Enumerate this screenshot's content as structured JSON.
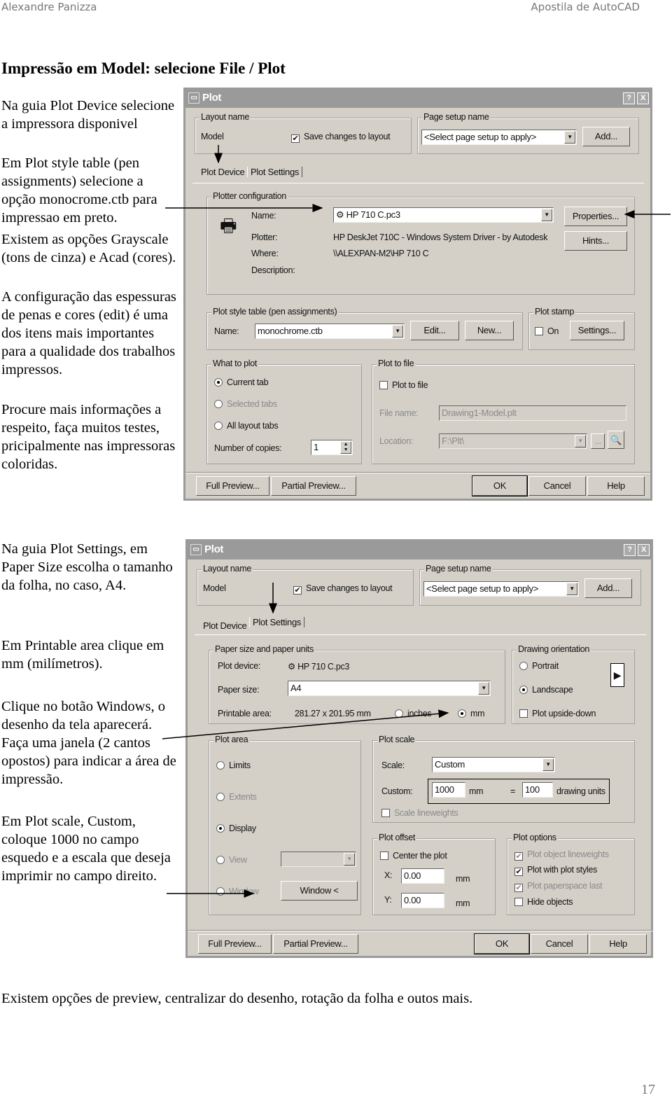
{
  "header": {
    "author": "Alexandre Panizza",
    "doc_title": "Apostila de AutoCAD"
  },
  "section_title": "Impressão em Model: selecione File / Plot",
  "left_text_1": [
    "Na guia Plot Device selecione a impressora disponivel",
    "Em Plot style table (pen assignments) selecione a opção monocrome.ctb para impressao em preto.",
    "Existem as opções Grayscale (tons de cinza) e Acad (cores).",
    "A configuração das espessuras de penas e cores (edit) é uma dos itens mais importantes para a qualidade dos trabalhos impressos.",
    "Procure mais informações a respeito, faça muitos testes, pricipalmente nas impressoras coloridas."
  ],
  "left_text_2": [
    "Na guia Plot Settings, em Paper Size escolha o tamanho da folha, no caso, A4.",
    "Em Printable area clique em mm (milímetros).",
    "Clique no botão Windows, o desenho da tela aparecerá. Faça uma janela (2 cantos opostos) para indicar a área de impressão.",
    "Em Plot scale, Custom, coloque 1000 no campo esquedo e a escala que deseja imprimir no campo direito."
  ],
  "footer_text": "Existem opções de preview, centralizar do desenho, rotação da folha e outos mais.",
  "page_number": "17",
  "dialog_common": {
    "title": "Plot",
    "help_btn": "?",
    "close_btn": "X",
    "layout_name_group": "Layout name",
    "layout_name": "Model",
    "save_changes": "Save changes to layout",
    "page_setup_group": "Page setup name",
    "page_setup_value": "<Select page setup to apply>",
    "add_btn": "Add...",
    "tab_device": "Plot Device",
    "tab_settings": "Plot Settings",
    "full_preview": "Full Preview...",
    "partial_preview": "Partial Preview...",
    "ok": "OK",
    "cancel": "Cancel",
    "help": "Help"
  },
  "dialog1": {
    "plotter_group": "Plotter configuration",
    "name_label": "Name:",
    "name_value": "HP 710 C.pc3",
    "plotter_label": "Plotter:",
    "plotter_value": "HP DeskJet 710C - Windows System Driver - by Autodesk",
    "where_label": "Where:",
    "where_value": "\\\\ALEXPAN-M2\\HP 710 C",
    "description_label": "Description:",
    "properties_btn": "Properties...",
    "hints_btn": "Hints...",
    "style_group": "Plot style table (pen assignments)",
    "style_name_label": "Name:",
    "style_value": "monochrome.ctb",
    "edit_btn": "Edit...",
    "new_btn": "New...",
    "stamp_group": "Plot stamp",
    "stamp_on": "On",
    "stamp_settings": "Settings...",
    "what_group": "What to plot",
    "current_tab": "Current tab",
    "selected_tabs": "Selected tabs",
    "all_layout_tabs": "All layout tabs",
    "copies_label": "Number of copies:",
    "copies_value": "1",
    "file_group": "Plot to file",
    "plot_to_file": "Plot to file",
    "file_name_label": "File name:",
    "file_name_value": "Drawing1-Model.plt",
    "location_label": "Location:",
    "location_value": "F:\\Plt\\",
    "browse_btn": "..."
  },
  "dialog2": {
    "paper_group": "Paper size and paper units",
    "plot_device_label": "Plot device:",
    "plot_device_value": "HP 710 C.pc3",
    "paper_size_label": "Paper size:",
    "paper_size_value": "A4",
    "printable_label": "Printable area:",
    "printable_value": "281.27 x 201.95 mm",
    "inches": "inches",
    "mm": "mm",
    "orient_group": "Drawing orientation",
    "portrait": "Portrait",
    "landscape": "Landscape",
    "upside_down": "Plot upside-down",
    "area_group": "Plot area",
    "limits": "Limits",
    "extents": "Extents",
    "display": "Display",
    "view": "View",
    "window": "Window",
    "window_btn": "Window <",
    "scale_group": "Plot scale",
    "scale_label": "Scale:",
    "scale_value": "Custom",
    "custom_label": "Custom:",
    "custom_left": "1000",
    "custom_unit": "mm",
    "equals": "=",
    "custom_right": "100",
    "drawing_units": "drawing units",
    "scale_lineweights": "Scale lineweights",
    "offset_group": "Plot offset",
    "center_plot": "Center the plot",
    "x_label": "X:",
    "x_value": "0.00",
    "y_label": "Y:",
    "y_value": "0.00",
    "offset_unit": "mm",
    "options_group": "Plot options",
    "opt_lineweights": "Plot object lineweights",
    "opt_styles": "Plot with plot styles",
    "opt_paperspace": "Plot paperspace last",
    "opt_hide": "Hide objects"
  }
}
